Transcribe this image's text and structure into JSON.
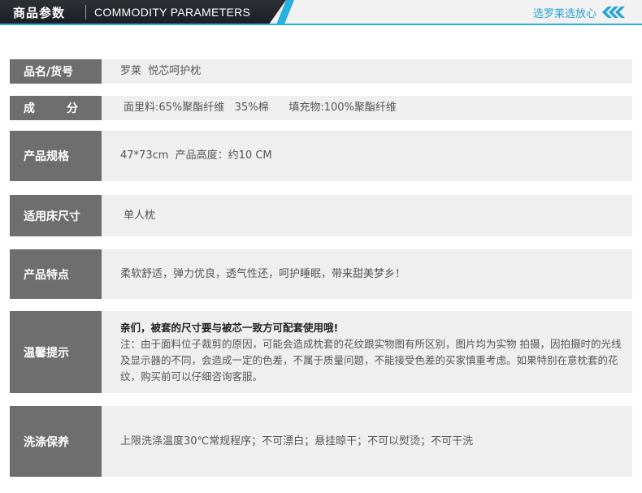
{
  "header": {
    "title_cn": "商品参数",
    "title_en": "COMMODITY PARAMETERS",
    "slogan": "选罗莱选放心",
    "chevrons_icon": "triple-chevron-left-icon",
    "colors": {
      "dark": "#1b1e22",
      "accent": "#28b0df",
      "label_bg": "#6e6e6e",
      "row_bg": "#efefef"
    }
  },
  "rows": [
    {
      "label": "品名/货号",
      "value": "罗莱  悦芯呵护枕"
    },
    {
      "label": "成        分",
      "value": "面里料:65%聚酯纤维   35%棉      填充物:100%聚酯纤维"
    },
    {
      "label": "产品规格",
      "value": "47*73cm  产品高度：约10 CM"
    },
    {
      "label": "适用床尺寸",
      "value": "单人枕"
    },
    {
      "label": "产品特点",
      "value": "柔软舒适，弹力优良，透气性还，呵护睡眠，带来甜美梦乡！"
    },
    {
      "label": "温馨提示",
      "value_strong": "亲们，被套的尺寸要与被芯一致方可配套使用哦!",
      "value": "注：由于面料位子裁剪的原因，可能会造成枕套的花纹跟实物图有所区别，图片均为实物 拍摄，因拍摄时的光线及显示器的不同，会造成一定的色差，不属于质量问题，不能接受色差的买家慎重考虑。如果特别在意枕套的花纹，购买前可以仔细咨询客服。"
    },
    {
      "label": "洗涤保养",
      "value": "上限洗涤温度30℃常规程序；不可漂白；悬挂晾干；不可以熨烫；不可干洗"
    }
  ]
}
